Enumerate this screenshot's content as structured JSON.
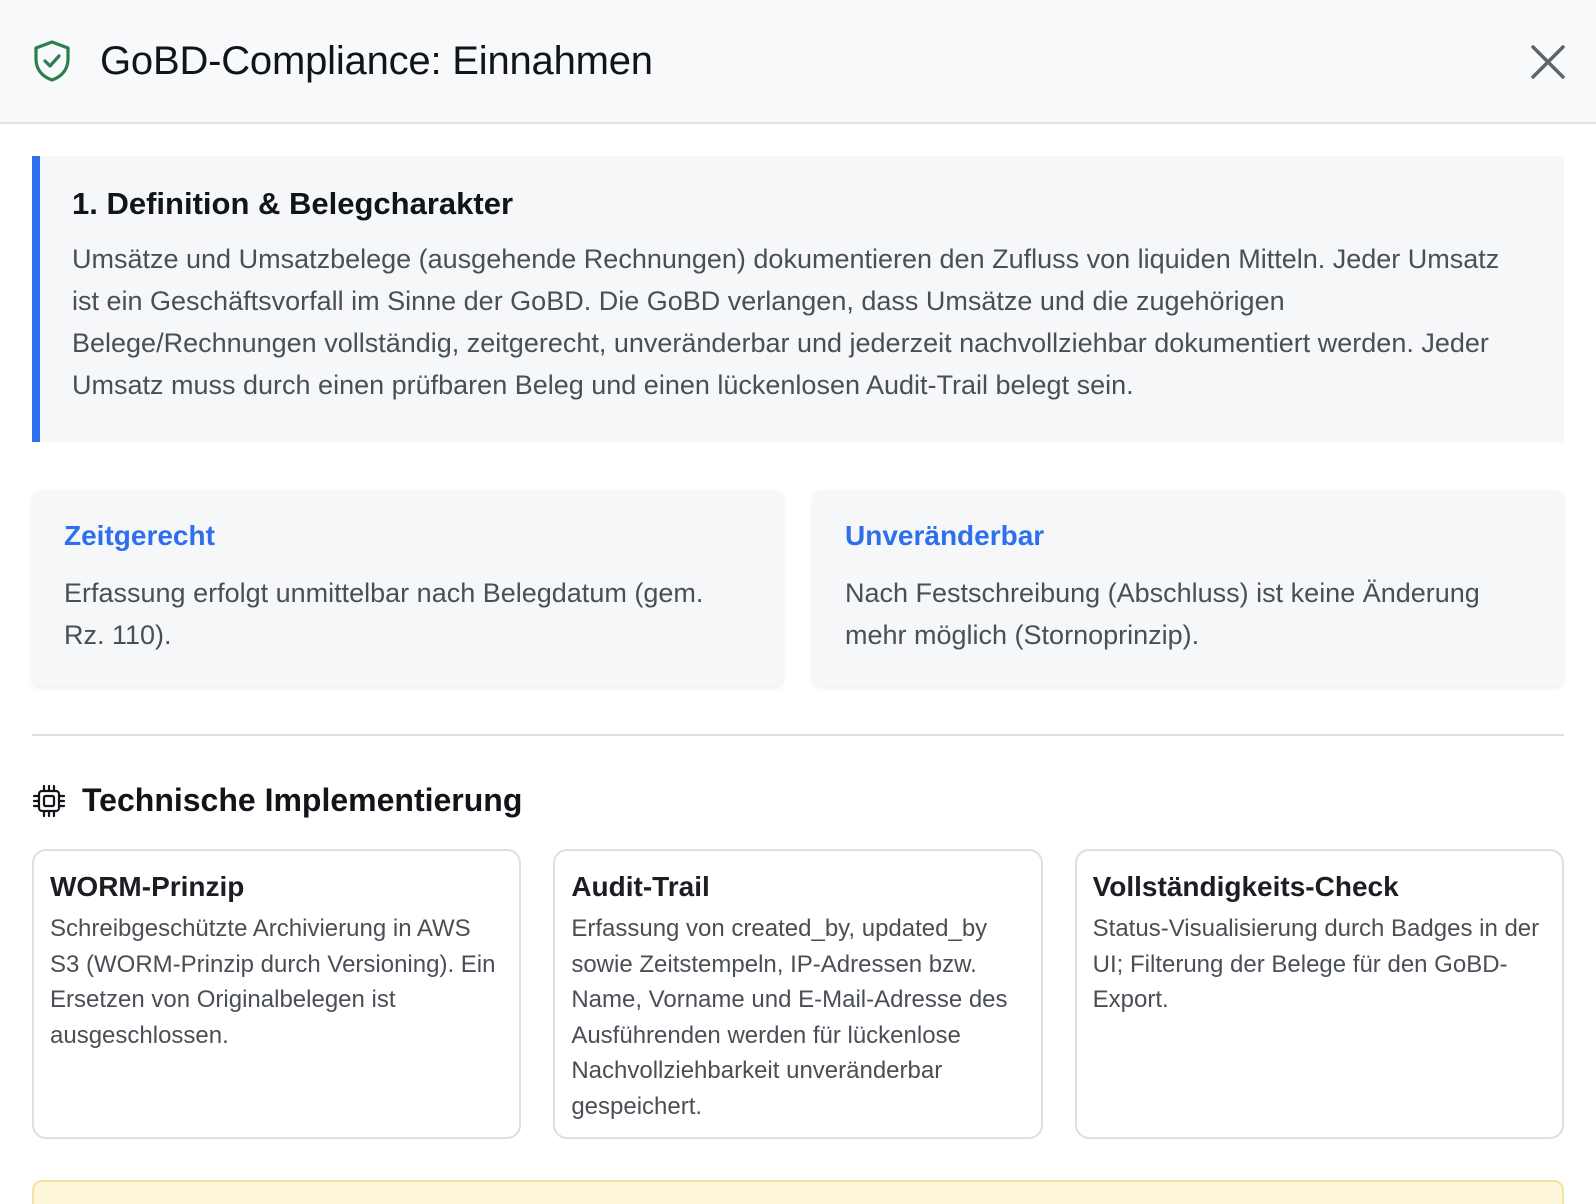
{
  "header": {
    "title": "GoBD-Compliance: Einnahmen",
    "accent_color": "#2e7d4f",
    "icon": "shield-check-icon",
    "close_icon": "close-icon"
  },
  "definition": {
    "heading": "1. Definition & Belegcharakter",
    "text": "Umsätze und Umsatzbelege (ausgehende Rechnungen) dokumentieren den Zufluss von liquiden Mitteln. Jeder Umsatz ist ein Geschäftsvorfall im Sinne der GoBD. Die GoBD verlangen, dass Umsätze und die zugehörigen Belege/Rechnungen vollständig, zeitgerecht, unveränderbar und jederzeit nachvollziehbar dokumentiert werden. Jeder Umsatz muss durch einen prüfbaren Beleg und einen lückenlosen Audit-Trail belegt sein.",
    "border_color": "#2f6fed"
  },
  "principles": [
    {
      "title": "Zeitgerecht",
      "text": "Erfassung erfolgt unmittelbar nach Belegdatum (gem. Rz. 110)."
    },
    {
      "title": "Unveränderbar",
      "text": "Nach Festschreibung (Abschluss) ist keine Änderung mehr möglich (Stornoprinzip)."
    }
  ],
  "tech": {
    "heading": "Technische Implementierung",
    "icon": "chip-icon",
    "cards": [
      {
        "title": "WORM-Prinzip",
        "text": "Schreibgeschützte Archivierung in AWS S3 (WORM-Prinzip durch Versioning). Ein Ersetzen von Originalbelegen ist ausgeschlossen."
      },
      {
        "title": "Audit-Trail",
        "text": "Erfassung von created_by, updated_by sowie Zeitstempeln, IP-Adressen bzw. Name, Vorname und E-Mail-Adresse des Ausführenden werden für lückenlose Nachvollziehbarkeit unveränderbar gespeichert."
      },
      {
        "title": "Vollständigkeits-Check",
        "text": "Status-Visualisierung durch Badges in der UI; Filterung der Belege für den GoBD-Export."
      }
    ]
  }
}
